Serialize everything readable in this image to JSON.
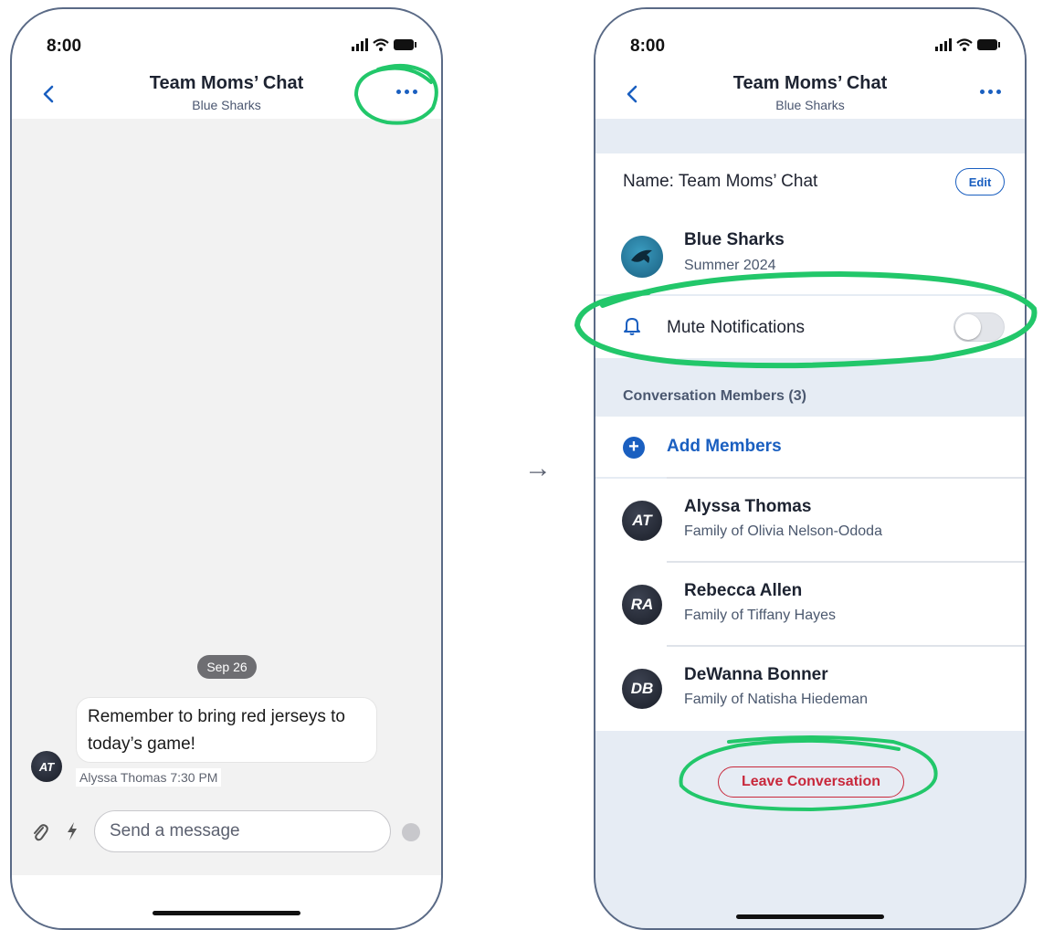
{
  "left_phone": {
    "status_time": "8:00",
    "nav": {
      "title": "Team Moms’ Chat",
      "subtitle": "Blue Sharks"
    },
    "date_pill": "Sep 26",
    "message": {
      "text": "Remember to bring red jerseys to today’s game!",
      "sender_initials": "AT",
      "meta": "Alyssa Thomas 7:30 PM"
    },
    "composer": {
      "placeholder": "Send a message"
    }
  },
  "right_phone": {
    "status_time": "8:00",
    "nav": {
      "title": "Team Moms’ Chat",
      "subtitle": "Blue Sharks"
    },
    "name_label": "Name: Team Moms’ Chat",
    "edit_label": "Edit",
    "team": {
      "name": "Blue Sharks",
      "season": "Summer 2024"
    },
    "mute": {
      "label": "Mute Notifications",
      "enabled": false
    },
    "members_header": "Conversation Members (3)",
    "add_members_label": "Add Members",
    "members": [
      {
        "initials": "AT",
        "name": "Alyssa Thomas",
        "family": "Family of Olivia Nelson-Ododa"
      },
      {
        "initials": "RA",
        "name": "Rebecca Allen",
        "family": "Family of Tiffany Hayes"
      },
      {
        "initials": "DB",
        "name": "DeWanna Bonner",
        "family": "Family of Natisha Hiedeman"
      }
    ],
    "leave_label": "Leave Conversation"
  },
  "arrow": "→",
  "colors": {
    "accent": "#1a5fc0",
    "danger": "#c8283b",
    "highlight": "#22c76a"
  }
}
